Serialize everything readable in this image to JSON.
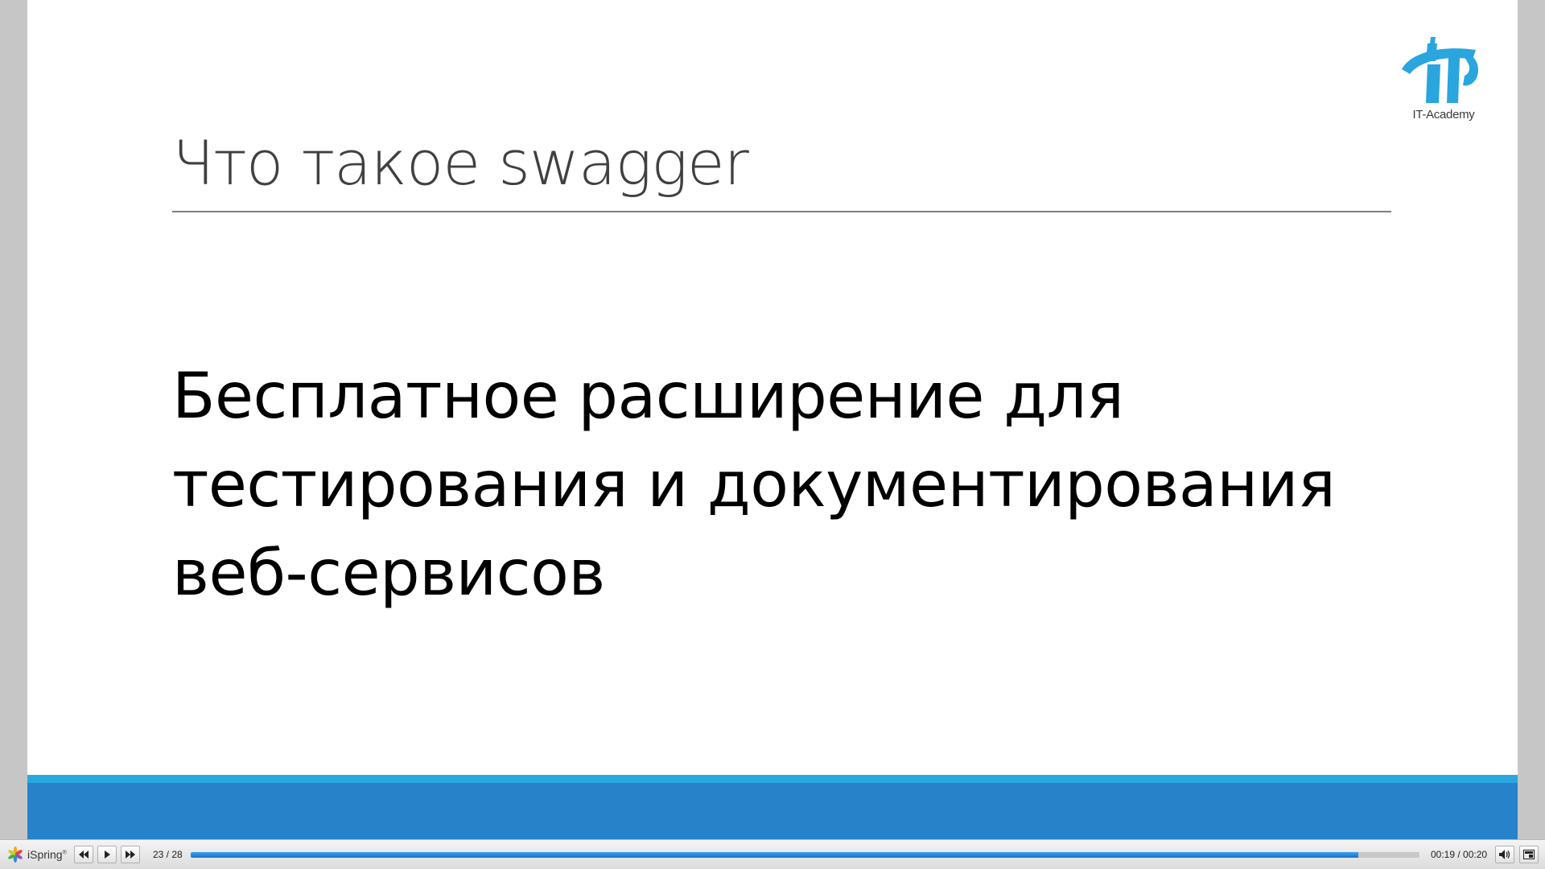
{
  "slide": {
    "title": "Что такое swagger",
    "body_lines": [
      "Бесплатное расширение для",
      "тестирования и документирования",
      "веб-сервисов"
    ],
    "logo_text": "IT-Academy"
  },
  "player": {
    "brand": "iSpring",
    "brand_mark": "®",
    "slide_counter": "23 / 28",
    "time": "00:19 / 00:20",
    "progress": 0.95
  },
  "colors": {
    "footer_light": "#29a8e0",
    "footer_dark": "#2782c9",
    "logo_blue": "#2aa5de",
    "progress_blue": "#1d6fd0"
  },
  "icons": {
    "prev": "rewind-icon",
    "play": "play-icon",
    "next": "fast-forward-icon",
    "volume": "speaker-icon",
    "fullscreen": "fullscreen-icon",
    "brand": "ispring-flower-icon"
  }
}
